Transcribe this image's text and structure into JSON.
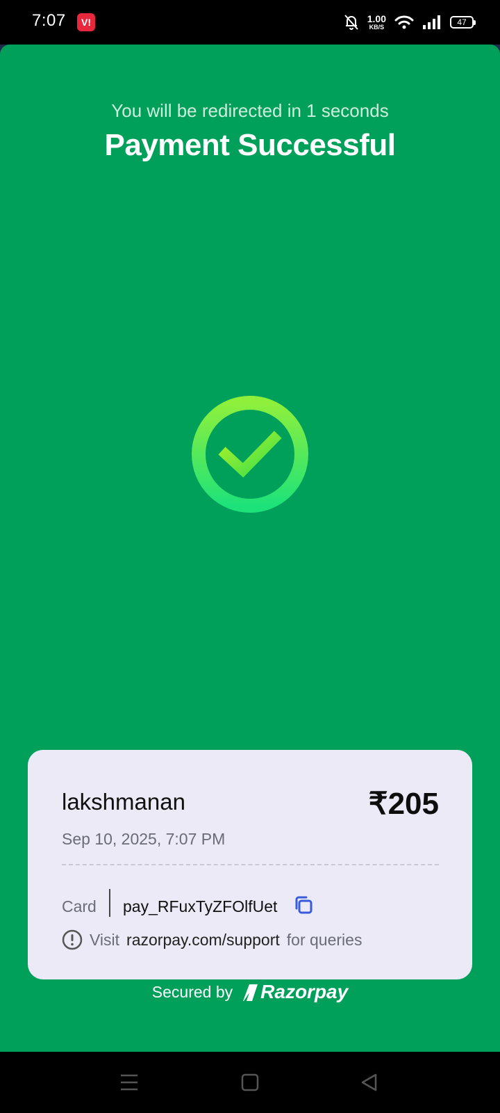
{
  "status_bar": {
    "time": "7:07",
    "carrier_badge": "V!",
    "net_speed_value": "1.00",
    "net_speed_unit": "KB/S",
    "battery": "47",
    "icons": [
      "mute-bell-icon",
      "wifi-icon",
      "signal-icon",
      "battery-icon"
    ]
  },
  "page": {
    "redirect_text": "You will be redirected in 1 seconds",
    "title": "Payment Successful"
  },
  "receipt": {
    "merchant": "lakshmanan",
    "amount": "₹205",
    "datetime": "Sep 10, 2025, 7:07 PM",
    "method": "Card",
    "payment_id": "pay_RFuxTyZFOlfUet",
    "support_prefix": "Visit",
    "support_link": "razorpay.com/support",
    "support_suffix": "for queries"
  },
  "footer": {
    "secured_by": "Secured by",
    "brand": "Razorpay"
  },
  "colors": {
    "background_green": "#00a05a",
    "card_background": "#ebeaf6",
    "check_ring": "#7df045",
    "copy_icon": "#3a5bd9"
  },
  "nav_bar": {
    "buttons": [
      "menu-icon",
      "home-icon",
      "back-icon"
    ]
  }
}
